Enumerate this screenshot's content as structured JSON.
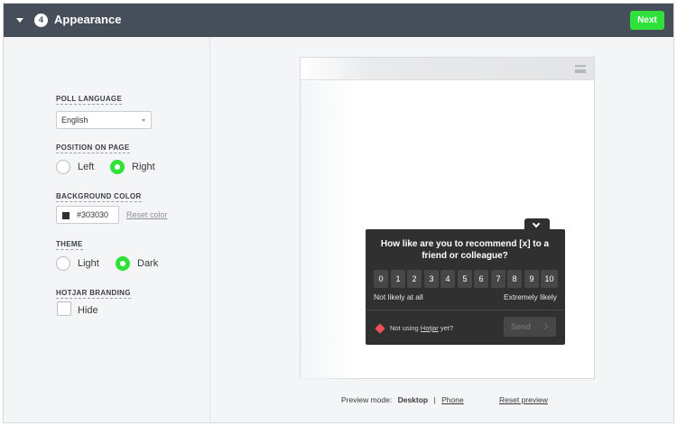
{
  "header": {
    "step_number": "4",
    "title": "Appearance",
    "next_label": "Next"
  },
  "settings": {
    "poll_language": {
      "label": "POLL LANGUAGE",
      "selected": "English"
    },
    "position": {
      "label": "POSITION ON PAGE",
      "options": [
        "Left",
        "Right"
      ],
      "selected": "Right"
    },
    "background_color": {
      "label": "BACKGROUND COLOR",
      "value": "#303030",
      "reset_label": "Reset color"
    },
    "theme": {
      "label": "THEME",
      "options": [
        "Light",
        "Dark"
      ],
      "selected": "Dark"
    },
    "branding": {
      "label": "HOTJAR BRANDING",
      "checkbox_label": "Hide",
      "checked": false
    }
  },
  "preview": {
    "question": "How like are you to recommend [x] to a friend or colleague?",
    "scale": [
      "0",
      "1",
      "2",
      "3",
      "4",
      "5",
      "6",
      "7",
      "8",
      "9",
      "10"
    ],
    "low_label": "Not likely at all",
    "high_label": "Extremely likely",
    "footer_prefix": "Not using ",
    "footer_link": "Hotjar",
    "footer_suffix": " yet?",
    "send_label": "Send",
    "mode_label": "Preview mode:",
    "mode_desktop": "Desktop",
    "mode_separator": "|",
    "mode_phone": "Phone",
    "reset_label": "Reset preview"
  },
  "colors": {
    "accent": "#2fe13a",
    "header_bg": "#454e59",
    "poll_bg": "#303030"
  },
  "icons": {
    "collapse": "caret-down-icon",
    "menu": "hamburger-menu-icon",
    "poll_toggle": "chevron-down-icon",
    "brand": "hotjar-heart-icon",
    "send": "chevron-right-icon"
  }
}
